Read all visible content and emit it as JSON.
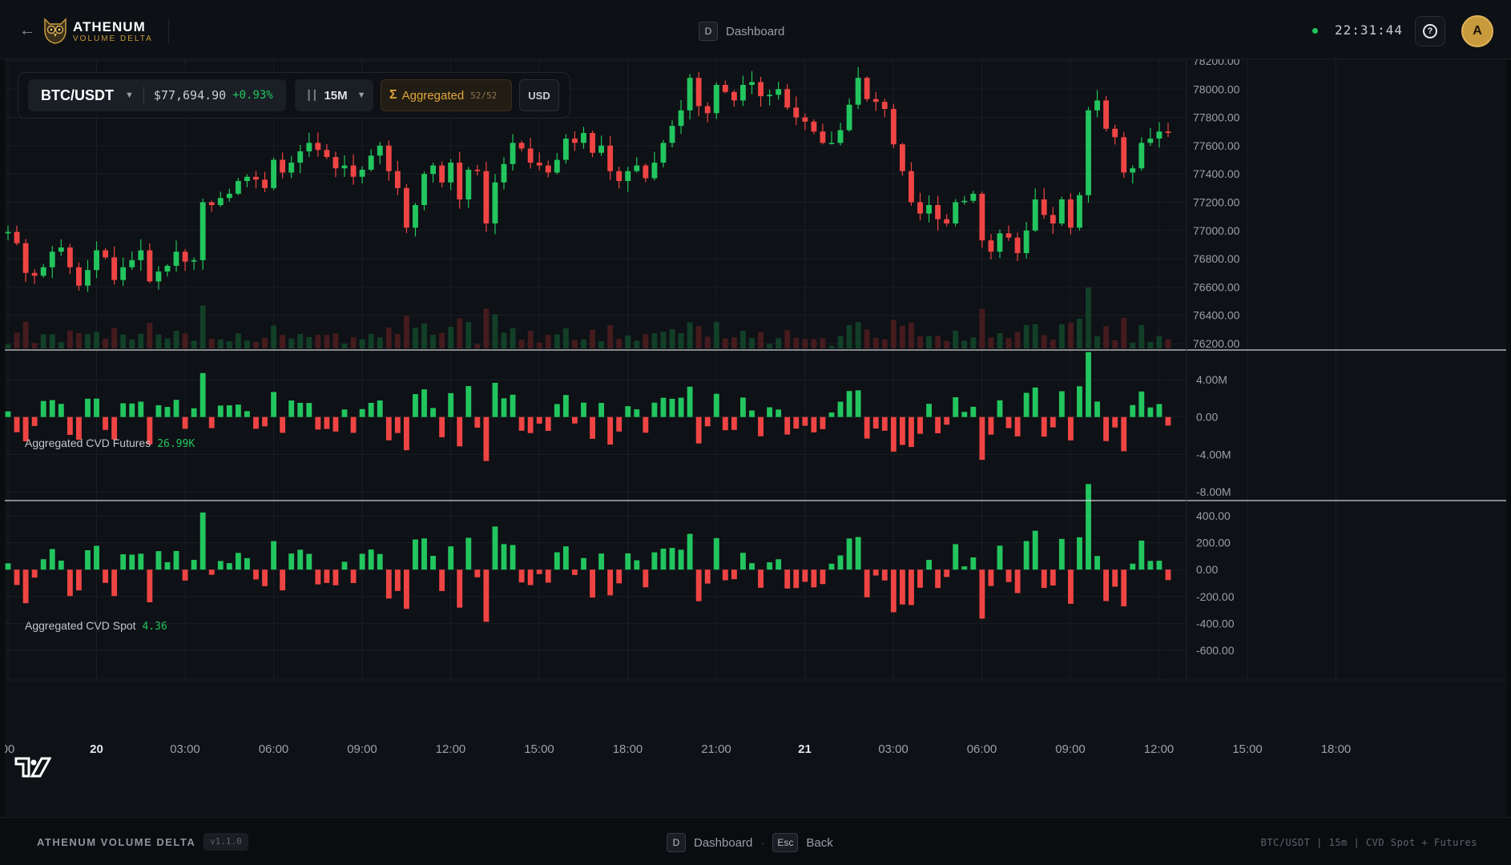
{
  "header": {
    "back_icon": "arrow-left-icon",
    "brand_name": "ATHENUM",
    "brand_sub": "VOLUME DELTA",
    "nav_key": "D",
    "nav_label": "Dashboard",
    "clock": "22:31:44",
    "help_icon": "question-circle-icon",
    "avatar_initial": "A"
  },
  "toolbar": {
    "symbol": "BTC/USDT",
    "price": "$77,694.90",
    "change": "+0.93%",
    "timeframe": "15M",
    "aggregate_icon": "Σ",
    "aggregate_label": "Aggregated",
    "aggregate_count": "52/52",
    "currency": "USD"
  },
  "panels": {
    "futures_label": "Aggregated CVD Futures",
    "futures_value": "26.99K",
    "spot_label": "Aggregated CVD Spot",
    "spot_value": "4.36"
  },
  "colors": {
    "up": "#22c55e",
    "down": "#ef4444",
    "accent": "#c79a3e",
    "grid": "#1b1f25"
  },
  "chart_data": {
    "type": "candlestick",
    "symbol": "BTC/USDT",
    "interval": "15m",
    "price_axis_ticks": [
      "78200.00",
      "78000.00",
      "77800.00",
      "77600.00",
      "77400.00",
      "77200.00",
      "77000.00",
      "76800.00",
      "76600.00",
      "76400.00",
      "76200.00"
    ],
    "price_range": [
      76200,
      78200
    ],
    "futures_axis_ticks": [
      "4.00M",
      "0.00",
      "-4.00M",
      "-8.00M"
    ],
    "futures_range": [
      -8000000,
      4000000
    ],
    "spot_axis_ticks": [
      "400.00",
      "200.00",
      "0.00",
      "-200.00",
      "-400.00",
      "-600.00"
    ],
    "spot_range": [
      -600,
      400
    ],
    "time_ticks": [
      "00",
      "20",
      "03:00",
      "06:00",
      "09:00",
      "12:00",
      "15:00",
      "18:00",
      "21:00",
      "21",
      "03:00",
      "06:00",
      "09:00",
      "12:00",
      "15:00",
      "18:00"
    ],
    "bold_time_ticks": [
      "20",
      "21"
    ],
    "closes": [
      76990,
      76910,
      76700,
      76680,
      76740,
      76850,
      76880,
      76740,
      76610,
      76720,
      76860,
      76810,
      76650,
      76740,
      76790,
      76860,
      76640,
      76710,
      76750,
      76850,
      76780,
      76790,
      77200,
      77180,
      77230,
      77260,
      77350,
      77380,
      77360,
      77300,
      77500,
      77410,
      77480,
      77560,
      77620,
      77570,
      77520,
      77440,
      77460,
      77380,
      77430,
      77530,
      77600,
      77420,
      77300,
      77020,
      77180,
      77400,
      77460,
      77340,
      77480,
      77220,
      77430,
      77420,
      77050,
      77340,
      77470,
      77620,
      77580,
      77480,
      77460,
      77410,
      77500,
      77650,
      77620,
      77690,
      77550,
      77600,
      77420,
      77350,
      77420,
      77460,
      77370,
      77480,
      77620,
      77740,
      77850,
      78080,
      77880,
      77830,
      78030,
      77980,
      77920,
      78030,
      78050,
      77950,
      77960,
      78000,
      77870,
      77800,
      77770,
      77700,
      77620,
      77620,
      77710,
      77890,
      78080,
      77930,
      77910,
      77860,
      77610,
      77420,
      77200,
      77120,
      77180,
      77080,
      77050,
      77200,
      77210,
      77260,
      76930,
      76850,
      76980,
      76950,
      76840,
      77000,
      77220,
      77110,
      77050,
      77220,
      77020,
      77250,
      77850,
      77920,
      77720,
      77660,
      77410,
      77440,
      77620,
      77650,
      77700,
      77690
    ]
  }
}
